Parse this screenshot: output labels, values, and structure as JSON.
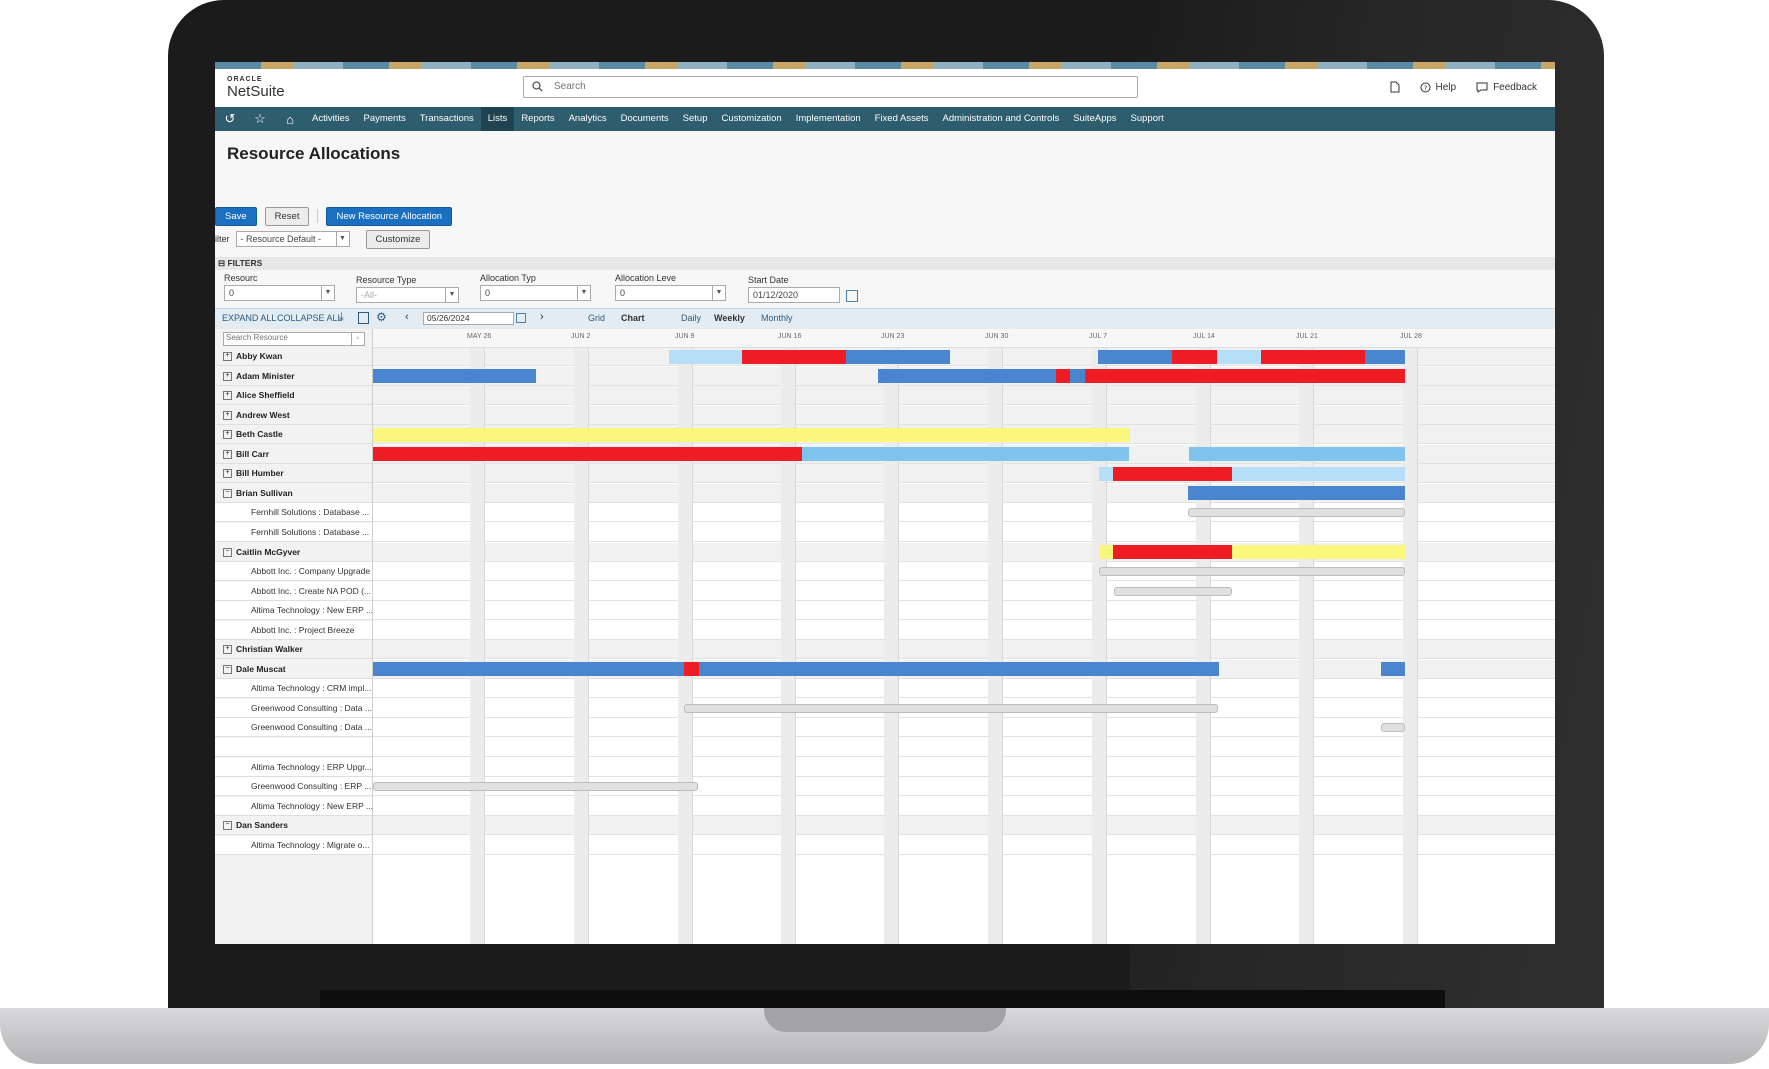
{
  "header": {
    "logo_oracle": "ORACLE",
    "logo_netsuite": "NetSuite",
    "search_placeholder": "Search",
    "help": "Help",
    "feedback": "Feedback"
  },
  "nav": {
    "items": [
      "Activities",
      "Payments",
      "Transactions",
      "Lists",
      "Reports",
      "Analytics",
      "Documents",
      "Setup",
      "Customization",
      "Implementation",
      "Fixed Assets",
      "Administration and Controls",
      "SuiteApps",
      "Support"
    ],
    "active": "Lists"
  },
  "page": {
    "title": "Resource Allocations",
    "save": "Save",
    "reset": "Reset",
    "new_allocation": "New Resource Allocation",
    "filter_label": "ilter",
    "filter_value": "- Resource Default -",
    "customize": "Customize"
  },
  "filters": {
    "header": "FILTERS",
    "resource_label": "Resourc",
    "resource_value": "0",
    "resource_type_label": "Resource Type",
    "resource_type_value": "-All-",
    "allocation_type_label": "Allocation Typ",
    "allocation_type_value": "0",
    "allocation_level_label": "Allocation Leve",
    "allocation_level_value": "0",
    "start_date_label": "Start Date",
    "start_date_value": "01/12/2020"
  },
  "toolbar": {
    "expand_all": "EXPAND ALL",
    "collapse_all": "COLLAPSE ALL",
    "date": "05/26/2024",
    "grid": "Grid",
    "chart": "Chart",
    "daily": "Daily",
    "weekly": "Weekly",
    "monthly": "Monthly"
  },
  "gantt": {
    "search_placeholder": "Search Resource",
    "date_labels": [
      "MAY 26",
      "JUN 2",
      "JUN 9",
      "JUN 16",
      "JUN 23",
      "JUN 30",
      "JUL 7",
      "JUL 14",
      "JUL 21",
      "JUL 28"
    ],
    "colors": {
      "blue": "#4a86cf",
      "red": "#ee1c25",
      "light_blue": "#7fc4ef",
      "pale_blue": "#b6def6",
      "yellow": "#fbf77c",
      "gray": "#dedede"
    },
    "rows": [
      {
        "type": "res",
        "label": "Abby Kwan",
        "toggle": "+"
      },
      {
        "type": "res",
        "label": "Adam Minister",
        "toggle": "+"
      },
      {
        "type": "res",
        "label": "Alice Sheffield",
        "toggle": "+"
      },
      {
        "type": "res",
        "label": "Andrew West",
        "toggle": "+"
      },
      {
        "type": "res",
        "label": "Beth Castle",
        "toggle": "+"
      },
      {
        "type": "res",
        "label": "Bill Carr",
        "toggle": "+"
      },
      {
        "type": "res",
        "label": "Bill Humber",
        "toggle": "+"
      },
      {
        "type": "res",
        "label": "Brian Sullivan",
        "toggle": "−"
      },
      {
        "type": "sub",
        "label": "Fernhill Solutions : Database ..."
      },
      {
        "type": "sub",
        "label": "Fernhill Solutions : Database ..."
      },
      {
        "type": "res",
        "label": "Caitlin McGyver",
        "toggle": "−"
      },
      {
        "type": "sub",
        "label": "Abbott Inc. : Company Upgrade"
      },
      {
        "type": "sub",
        "label": "Abbott Inc. : Create NA POD (..."
      },
      {
        "type": "sub",
        "label": "Altima Technology : New ERP ..."
      },
      {
        "type": "sub",
        "label": "Abbott Inc. : Project Breeze"
      },
      {
        "type": "res",
        "label": "Christian Walker",
        "toggle": "+"
      },
      {
        "type": "res",
        "label": "Dale Muscat",
        "toggle": "−"
      },
      {
        "type": "sub",
        "label": "Altima Technology : CRM impl..."
      },
      {
        "type": "sub",
        "label": "Greenwood Consulting : Data ..."
      },
      {
        "type": "sub",
        "label": "Greenwood Consulting : Data ..."
      },
      {
        "type": "sub",
        "label": ""
      },
      {
        "type": "sub",
        "label": "Altima Technology : ERP Upgr..."
      },
      {
        "type": "sub",
        "label": "Greenwood Consulting : ERP ..."
      },
      {
        "type": "sub",
        "label": "Altima Technology : New ERP ..."
      },
      {
        "type": "res",
        "label": "Dan Sanders",
        "toggle": "−"
      },
      {
        "type": "sub",
        "label": "Altima Technology : Migrate o..."
      }
    ]
  }
}
